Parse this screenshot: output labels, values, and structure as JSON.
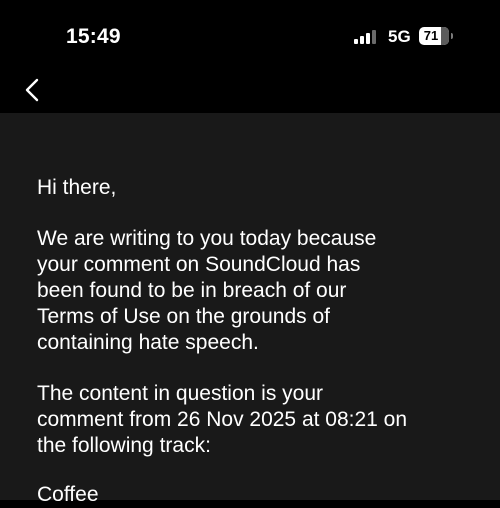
{
  "status_bar": {
    "time": "15:49",
    "network": "5G",
    "battery_level": "71",
    "signal_icon": "cellular-signal-icon",
    "battery_icon": "battery-icon"
  },
  "nav": {
    "back_icon": "chevron-left-icon"
  },
  "message": {
    "greeting": "Hi there,",
    "paragraph_1": "We are writing to you today because\nyour comment on SoundCloud has\nbeen found to be in breach of our\nTerms of Use on the grounds of\ncontaining hate speech.",
    "paragraph_2": "The content in question is your\ncomment from 26 Nov 2025 at 08:21 on\nthe following track:",
    "track_name": "Coffee"
  },
  "colors": {
    "background": "#000000",
    "content_background": "#191919",
    "text": "#ffffff"
  }
}
